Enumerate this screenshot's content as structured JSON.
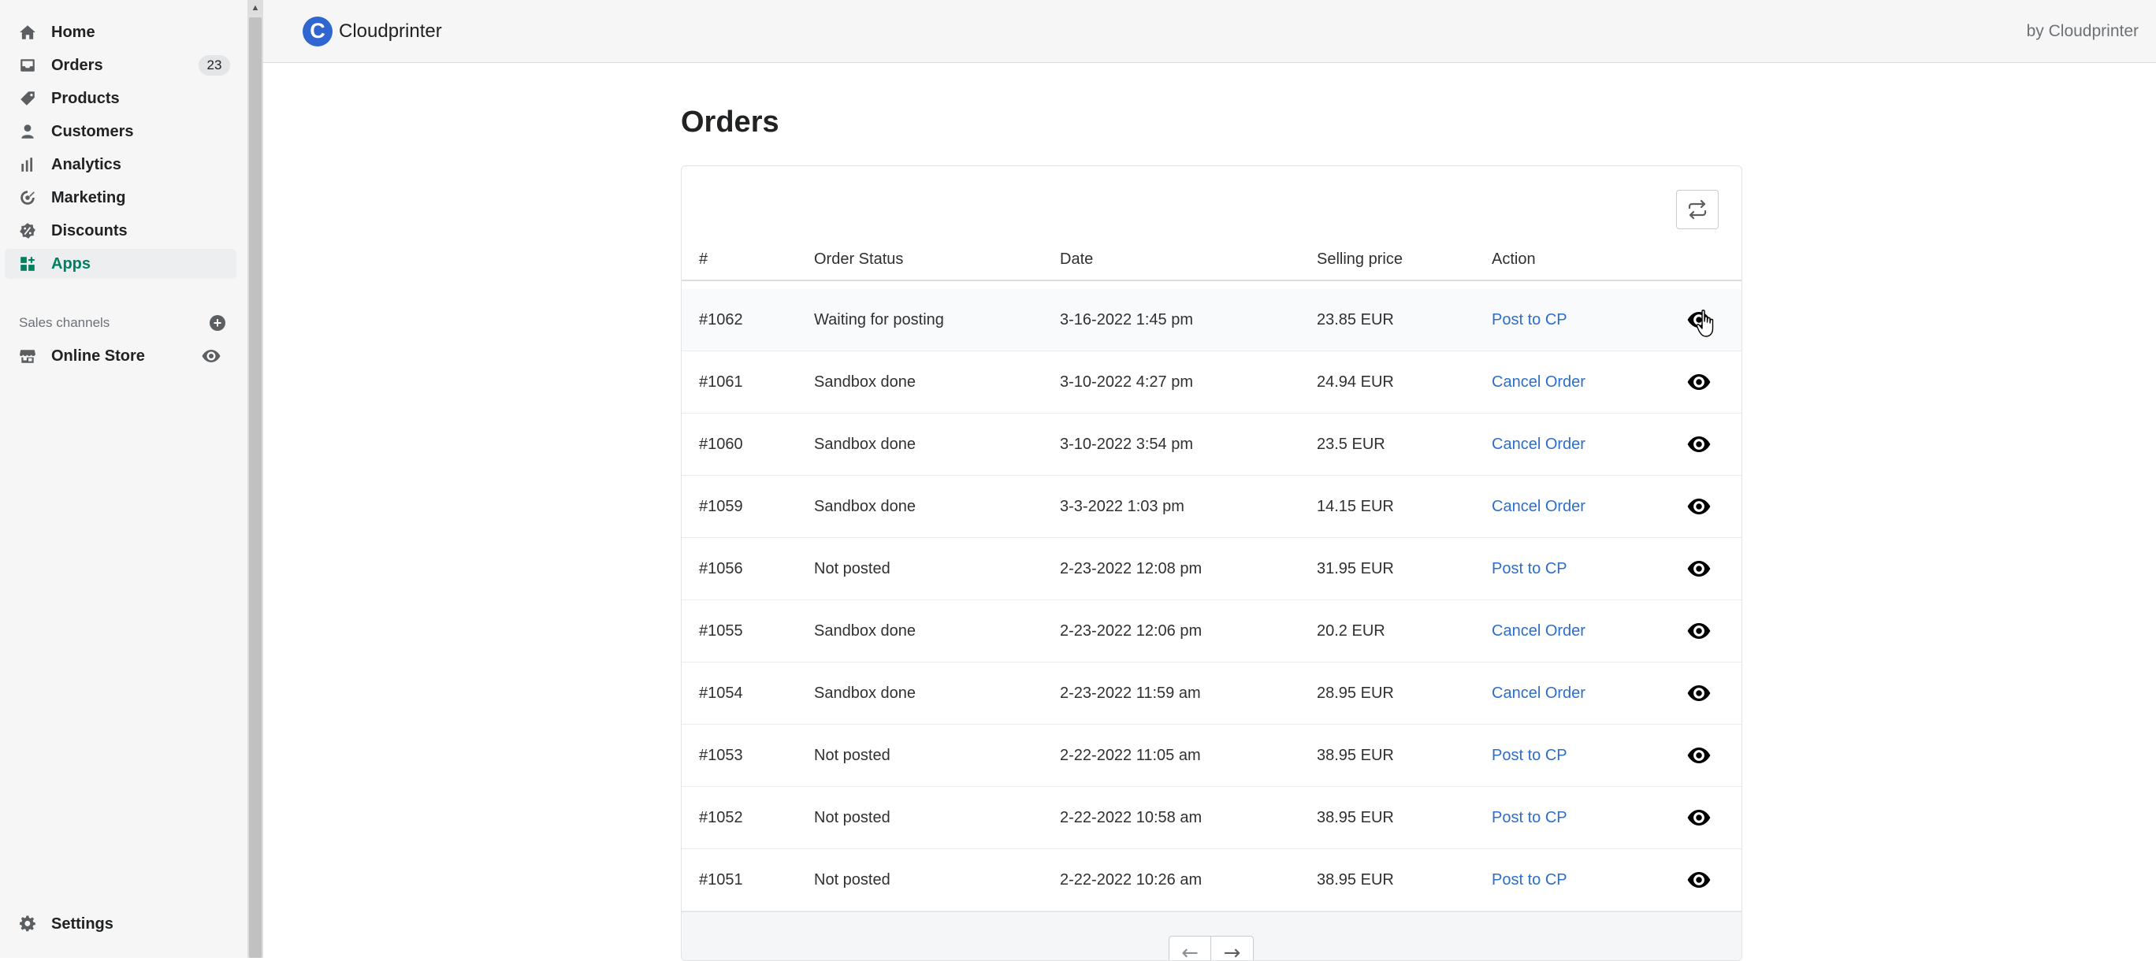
{
  "sidebar": {
    "nav": [
      {
        "label": "Home",
        "icon": "home-icon"
      },
      {
        "label": "Orders",
        "icon": "orders-icon",
        "badge": "23"
      },
      {
        "label": "Products",
        "icon": "tag-icon"
      },
      {
        "label": "Customers",
        "icon": "person-icon"
      },
      {
        "label": "Analytics",
        "icon": "bar-chart-icon"
      },
      {
        "label": "Marketing",
        "icon": "target-icon"
      },
      {
        "label": "Discounts",
        "icon": "discount-icon"
      },
      {
        "label": "Apps",
        "icon": "apps-icon",
        "active": true
      }
    ],
    "sales_channels_label": "Sales channels",
    "online_store_label": "Online Store",
    "settings_label": "Settings"
  },
  "topbar": {
    "app_name": "Cloudprinter",
    "by_label": "by Cloudprinter"
  },
  "page": {
    "title": "Orders"
  },
  "table": {
    "headers": {
      "num": "#",
      "status": "Order Status",
      "date": "Date",
      "price": "Selling price",
      "action": "Action"
    },
    "rows": [
      {
        "num": "#1062",
        "status": "Waiting for posting",
        "date": "3-16-2022 1:45 pm",
        "price": "23.85 EUR",
        "action": "Post to CP"
      },
      {
        "num": "#1061",
        "status": "Sandbox done",
        "date": "3-10-2022 4:27 pm",
        "price": "24.94 EUR",
        "action": "Cancel Order"
      },
      {
        "num": "#1060",
        "status": "Sandbox done",
        "date": "3-10-2022 3:54 pm",
        "price": "23.5 EUR",
        "action": "Cancel Order"
      },
      {
        "num": "#1059",
        "status": "Sandbox done",
        "date": "3-3-2022 1:03 pm",
        "price": "14.15 EUR",
        "action": "Cancel Order"
      },
      {
        "num": "#1056",
        "status": "Not posted",
        "date": "2-23-2022 12:08 pm",
        "price": "31.95 EUR",
        "action": "Post to CP"
      },
      {
        "num": "#1055",
        "status": "Sandbox done",
        "date": "2-23-2022 12:06 pm",
        "price": "20.2 EUR",
        "action": "Cancel Order"
      },
      {
        "num": "#1054",
        "status": "Sandbox done",
        "date": "2-23-2022 11:59 am",
        "price": "28.95 EUR",
        "action": "Cancel Order"
      },
      {
        "num": "#1053",
        "status": "Not posted",
        "date": "2-22-2022 11:05 am",
        "price": "38.95 EUR",
        "action": "Post to CP"
      },
      {
        "num": "#1052",
        "status": "Not posted",
        "date": "2-22-2022 10:58 am",
        "price": "38.95 EUR",
        "action": "Post to CP"
      },
      {
        "num": "#1051",
        "status": "Not posted",
        "date": "2-22-2022 10:26 am",
        "price": "38.95 EUR",
        "action": "Post to CP"
      }
    ]
  },
  "pagination": {
    "prev": "←",
    "next": "→"
  },
  "colors": {
    "accent": "#008060",
    "link": "#2c6ecb",
    "logo": "#2f66d0"
  }
}
